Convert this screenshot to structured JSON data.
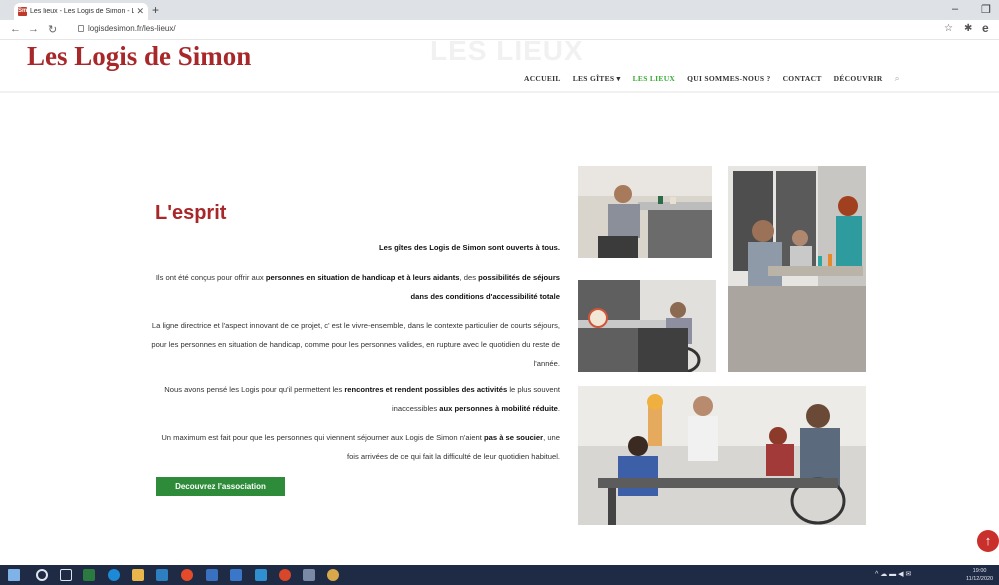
{
  "browser": {
    "tab_title": "Les lieux - Les Logis de Simon - L",
    "tab_favicon": "Sm",
    "tab_close": "✕",
    "new_tab": "+",
    "url": "logisdesimon.fr/les-lieux/",
    "minimize": "–",
    "restore": "❐"
  },
  "site": {
    "logo": "Les Logis de Simon",
    "ghost_title": "LES LIEUX",
    "nav": [
      {
        "label": "ACCUEIL"
      },
      {
        "label": "LES GÎTES ▾"
      },
      {
        "label": "LES LIEUX"
      },
      {
        "label": "QUI SOMMES-NOUS ?"
      },
      {
        "label": "CONTACT"
      },
      {
        "label": "DÉCOUVRIR"
      }
    ]
  },
  "content": {
    "heading": "L'esprit",
    "p1": "Les gîtes des Logis de Simon sont ouverts à tous.",
    "p2_a": "Ils ont été conçus pour offrir aux ",
    "p2_b": "personnes en situation de handicap et à leurs aidants",
    "p2_c": ", des ",
    "p2_d": "possibilités de séjours dans des conditions d'accessibilité totale",
    "p3": "La ligne directrice et l'aspect innovant de ce projet, c' est le vivre-ensemble, dans le contexte particulier de courts séjours,  pour les personnes en situation de handicap, comme pour les personnes valides, en rupture avec le quotidien du reste de l'année.",
    "p4_a": "Nous avons pensé les Logis pour qu'il permettent les ",
    "p4_b": "rencontres et rendent possibles des activités",
    "p4_c": " le plus souvent  inaccessibles ",
    "p4_d": "aux personnes à mobilité réduite",
    "p4_e": ".",
    "p5_a": "Un maximum est fait pour que les personnes qui viennent séjourner aux Logis de Simon n'aient ",
    "p5_b": "pas à se soucier",
    "p5_c": ", une fois arrivées de ce qui fait la difficulté de leur quotidien habituel.",
    "cta": "Decouvrez l'association"
  },
  "taskbar": {
    "time": "19:00",
    "date": "11/12/2020"
  }
}
